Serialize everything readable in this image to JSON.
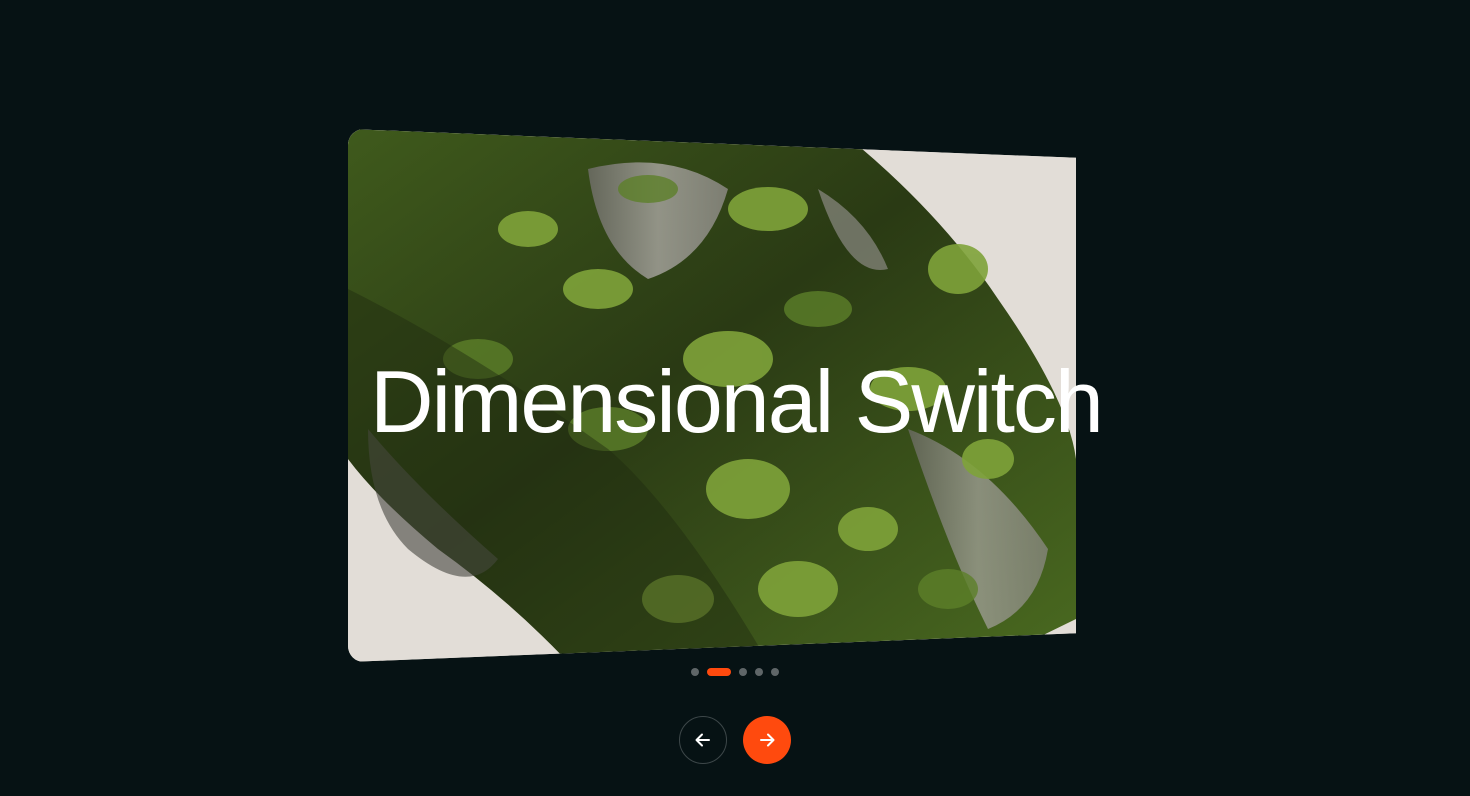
{
  "slider": {
    "title": "Dimensional Switch",
    "slide_count": 5,
    "active_index": 1
  },
  "navigation": {
    "prev_icon": "arrow-left-icon",
    "next_icon": "arrow-right-icon"
  },
  "colors": {
    "background": "#061214",
    "accent": "#ff4a0e",
    "dot_inactive": "#5f6668",
    "image_backdrop": "#e2ddd7",
    "moss_dark": "#2d3f16",
    "moss": "#4d6b22",
    "fern": "#7fa33a",
    "rock": "#9c9a93"
  }
}
